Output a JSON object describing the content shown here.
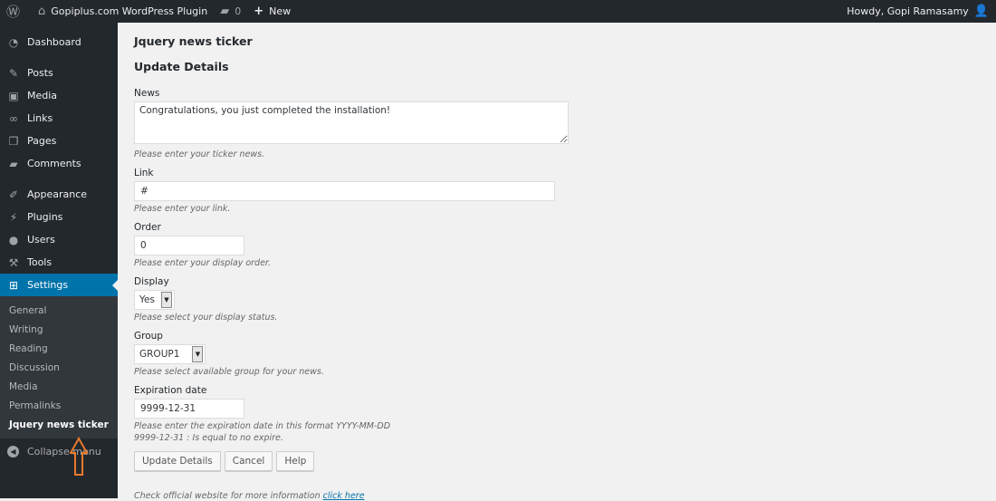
{
  "adminbar": {
    "wp_logo_icon": "wordpress-logo-icon",
    "site_name": "Gopiplus.com WordPress Plugin",
    "comments_count": "0",
    "new_label": "New",
    "greeting": "Howdy, Gopi Ramasamy"
  },
  "sidebar": {
    "items": [
      {
        "label": "Dashboard",
        "icon": "dashboard-icon"
      },
      {
        "label": "Posts",
        "icon": "pin-icon"
      },
      {
        "label": "Media",
        "icon": "media-icon"
      },
      {
        "label": "Links",
        "icon": "link-icon"
      },
      {
        "label": "Pages",
        "icon": "pages-icon"
      },
      {
        "label": "Comments",
        "icon": "comment-icon"
      },
      {
        "label": "Appearance",
        "icon": "brush-icon"
      },
      {
        "label": "Plugins",
        "icon": "plugin-icon"
      },
      {
        "label": "Users",
        "icon": "user-icon"
      },
      {
        "label": "Tools",
        "icon": "wrench-icon"
      },
      {
        "label": "Settings",
        "icon": "settings-icon"
      }
    ],
    "submenu": [
      "General",
      "Writing",
      "Reading",
      "Discussion",
      "Media",
      "Permalinks",
      "Jquery news ticker"
    ],
    "collapse_label": "Collapse menu"
  },
  "main": {
    "page_title": "Jquery news ticker",
    "section_title": "Update Details",
    "news": {
      "label": "News",
      "value": "Congratulations, you just completed the installation!",
      "help": "Please enter your ticker news."
    },
    "link": {
      "label": "Link",
      "value": "#",
      "help": "Please enter your link."
    },
    "order": {
      "label": "Order",
      "value": "0",
      "help": "Please enter your display order."
    },
    "display": {
      "label": "Display",
      "value": "Yes",
      "help": "Please select your display status."
    },
    "group": {
      "label": "Group",
      "value": "GROUP1",
      "help": "Please select available group for your news."
    },
    "expiration": {
      "label": "Expiration date",
      "value": "9999-12-31",
      "help1": "Please enter the expiration date in this format YYYY-MM-DD",
      "help2": "9999-12-31 : Is equal to no expire."
    },
    "buttons": {
      "update": "Update Details",
      "cancel": "Cancel",
      "help": "Help"
    },
    "footer_text": "Check official website for more information",
    "footer_link": "click here"
  },
  "colors": {
    "accent": "#0073aa",
    "sidebar_bg": "#23282d",
    "annotation_arrow": "#e8792b"
  }
}
